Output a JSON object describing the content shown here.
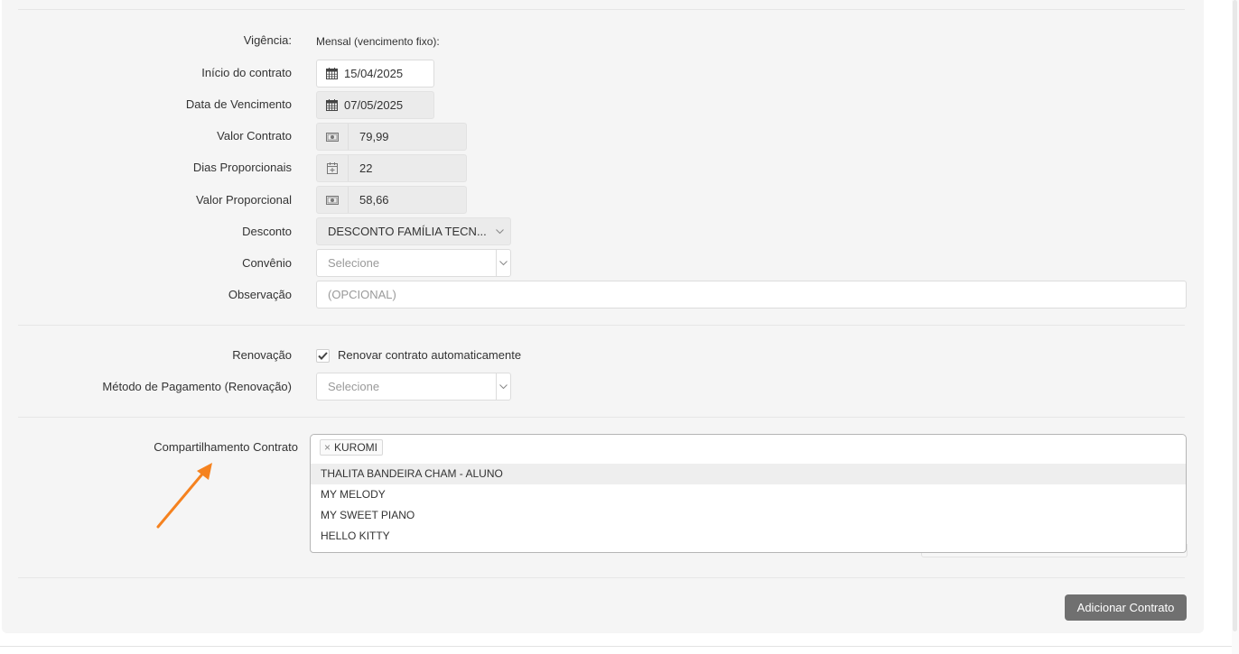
{
  "form": {
    "vigencia": {
      "label": "Vigência:",
      "value": "Mensal (vencimento fixo):"
    },
    "inicio_contrato": {
      "label": "Início do contrato",
      "value": "15/04/2025",
      "icon": "calendar-icon"
    },
    "data_vencimento": {
      "label": "Data de Vencimento",
      "value": "07/05/2025",
      "icon": "calendar-icon"
    },
    "valor_contrato": {
      "label": "Valor Contrato",
      "value": "79,99",
      "icon": "money-icon"
    },
    "dias_proporcionais": {
      "label": "Dias Proporcionais",
      "value": "22",
      "icon": "calendar-plus-icon"
    },
    "valor_proporcional": {
      "label": "Valor Proporcional",
      "value": "58,66",
      "icon": "money-icon"
    },
    "desconto": {
      "label": "Desconto",
      "value": "DESCONTO FAMÍLIA TECN..."
    },
    "convenio": {
      "label": "Convênio",
      "placeholder": "Selecione"
    },
    "observacao": {
      "label": "Observação",
      "placeholder": "(OPCIONAL)"
    }
  },
  "renovacao": {
    "label": "Renovação",
    "checkbox_label": "Renovar contrato automaticamente",
    "checked": true,
    "metodo_label": "Método de Pagamento (Renovação)",
    "metodo_placeholder": "Selecione"
  },
  "compartilhamento": {
    "label": "Compartilhamento Contrato",
    "selected_tags": [
      "KUROMI"
    ],
    "remove_glyph": "×",
    "options": [
      "THALITA BANDEIRA CHAM - ALUNO",
      "MY MELODY",
      "MY SWEET PIANO",
      "HELLO KITTY"
    ],
    "highlighted_option": 0
  },
  "actions": {
    "add_contract_label": "Adicionar Contrato"
  },
  "colors": {
    "panel_bg": "#f5f5f5",
    "button_bg": "#707070",
    "annotation_arrow": "#f5821f"
  }
}
